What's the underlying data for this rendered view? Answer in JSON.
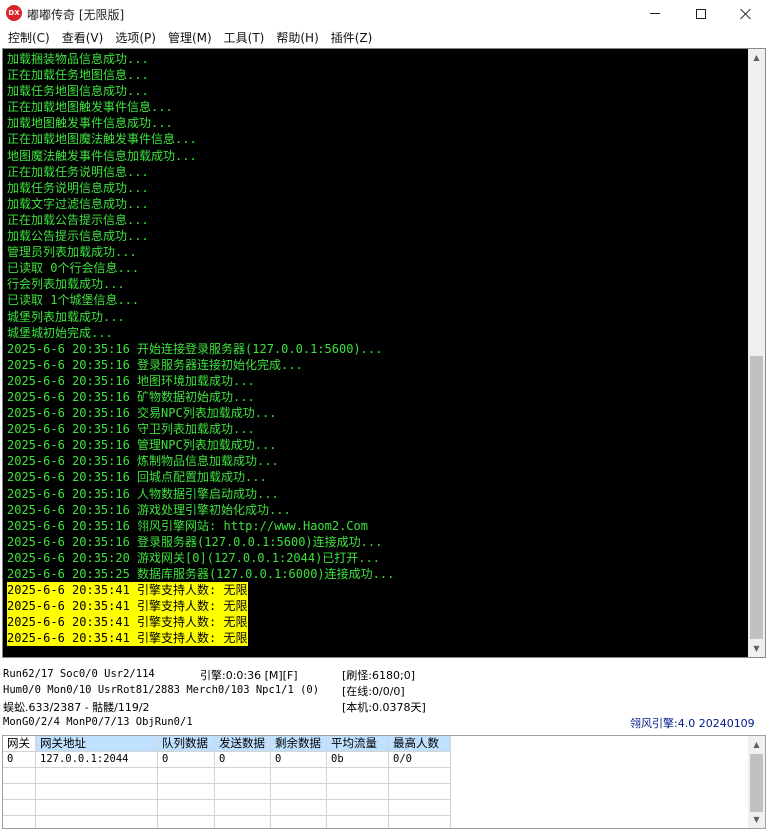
{
  "window": {
    "icon_text": "DX",
    "title": "嘟嘟传奇 [无限版]"
  },
  "menu": [
    "控制(C)",
    "查看(V)",
    "选项(P)",
    "管理(M)",
    "工具(T)",
    "帮助(H)",
    "插件(Z)"
  ],
  "console": {
    "lines": [
      "加载捆装物品信息成功...",
      "正在加载任务地图信息...",
      "加载任务地图信息成功...",
      "正在加载地图触发事件信息...",
      "加载地图触发事件信息成功...",
      "正在加载地图魔法触发事件信息...",
      "地图魔法触发事件信息加载成功...",
      "正在加载任务说明信息...",
      "加载任务说明信息成功...",
      "加载文字过滤信息成功...",
      "正在加载公告提示信息...",
      "加载公告提示信息成功...",
      "管理员列表加载成功...",
      "已读取 0个行会信息...",
      "行会列表加载成功...",
      "已读取 1个城堡信息...",
      "城堡列表加载成功...",
      "城堡城初始完成...",
      "2025-6-6 20:35:16 开始连接登录服务器(127.0.0.1:5600)...",
      "2025-6-6 20:35:16 登录服务器连接初始化完成...",
      "2025-6-6 20:35:16 地图环境加载成功...",
      "2025-6-6 20:35:16 矿物数据初始成功...",
      "2025-6-6 20:35:16 交易NPC列表加载成功...",
      "2025-6-6 20:35:16 守卫列表加载成功...",
      "2025-6-6 20:35:16 管理NPC列表加载成功...",
      "2025-6-6 20:35:16 炼制物品信息加载成功...",
      "2025-6-6 20:35:16 回城点配置加载成功...",
      "2025-6-6 20:35:16 人物数据引擎启动成功...",
      "2025-6-6 20:35:16 游戏处理引擎初始化成功...",
      "2025-6-6 20:35:16 翎风引擎网站: http://www.Haom2.Com",
      "2025-6-6 20:35:16 登录服务器(127.0.0.1:5600)连接成功...",
      "2025-6-6 20:35:20 游戏网关[0](127.0.0.1:2044)已打开...",
      "2025-6-6 20:35:25 数据库服务器(127.0.0.1:6000)连接成功..."
    ],
    "highlighted_lines": [
      "2025-6-6 20:35:41 引擎支持人数: 无限",
      "2025-6-6 20:35:41 引擎支持人数: 无限",
      "2025-6-6 20:35:41 引擎支持人数: 无限",
      "2025-6-6 20:35:41 引擎支持人数: 无限"
    ],
    "text_color": "#3ee23e",
    "highlight_color": "#ffff00"
  },
  "status": {
    "run": "Run62/17 Soc0/0 Usr2/114",
    "engine": "引擎:0:0:36 [M][F]",
    "refresh": "[刷怪:6180;0]",
    "hum": "Hum0/0 Mon0/10 UsrRot81/2883 Merch0/103 Npc1/1 (0)",
    "online": "[在线:0/0/0]",
    "monsters": "蜈蚣.633/2387 - 骷髅/119/2",
    "local": "[本机:0.0378天]",
    "mon_gen": "MonG0/2/4 MonP0/7/13 ObjRun0/1",
    "engine_version": "翎风引擎:4.0 20240109"
  },
  "gateway_table": {
    "headers": [
      "网关",
      "网关地址",
      "队列数据",
      "发送数据",
      "剩余数据",
      "平均流量",
      "最高人数"
    ],
    "rows": [
      [
        "0",
        "127.0.0.1:2044",
        "0",
        "0",
        "0",
        "0b",
        "0/0"
      ]
    ]
  }
}
